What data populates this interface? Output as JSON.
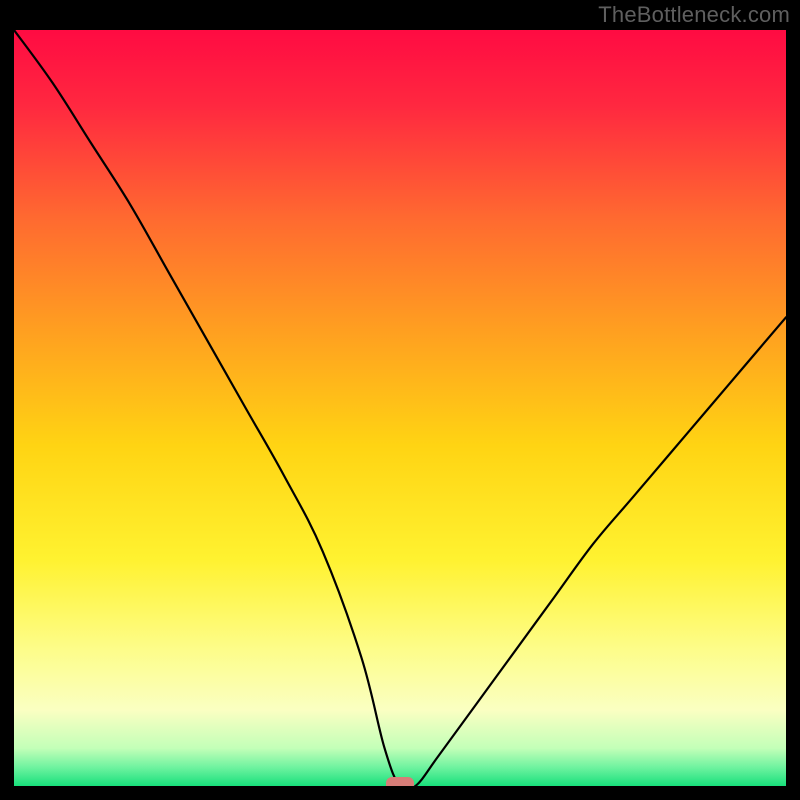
{
  "watermark": "TheBottleneck.com",
  "chart_data": {
    "type": "line",
    "title": "",
    "xlabel": "",
    "ylabel": "",
    "xlim": [
      0,
      100
    ],
    "ylim": [
      0,
      100
    ],
    "grid": false,
    "legend": false,
    "minimum_marker": {
      "x": 50,
      "y": 0
    },
    "series": [
      {
        "name": "bottleneck-curve",
        "x": [
          0,
          5,
          10,
          15,
          20,
          25,
          30,
          35,
          40,
          45,
          48,
          50,
          52,
          55,
          60,
          65,
          70,
          75,
          80,
          85,
          90,
          95,
          100
        ],
        "y": [
          100,
          93,
          85,
          77,
          68,
          59,
          50,
          41,
          31,
          17,
          5,
          0,
          0,
          4,
          11,
          18,
          25,
          32,
          38,
          44,
          50,
          56,
          62
        ]
      }
    ],
    "background_gradient": {
      "stops": [
        {
          "pos": 0.0,
          "color": "#ff0b42"
        },
        {
          "pos": 0.1,
          "color": "#ff2840"
        },
        {
          "pos": 0.25,
          "color": "#ff6a30"
        },
        {
          "pos": 0.4,
          "color": "#ffa020"
        },
        {
          "pos": 0.55,
          "color": "#ffd413"
        },
        {
          "pos": 0.7,
          "color": "#fff230"
        },
        {
          "pos": 0.82,
          "color": "#fdfd8a"
        },
        {
          "pos": 0.9,
          "color": "#faffc2"
        },
        {
          "pos": 0.95,
          "color": "#c3ffb8"
        },
        {
          "pos": 0.975,
          "color": "#70f3a0"
        },
        {
          "pos": 1.0,
          "color": "#18e07b"
        }
      ]
    }
  }
}
